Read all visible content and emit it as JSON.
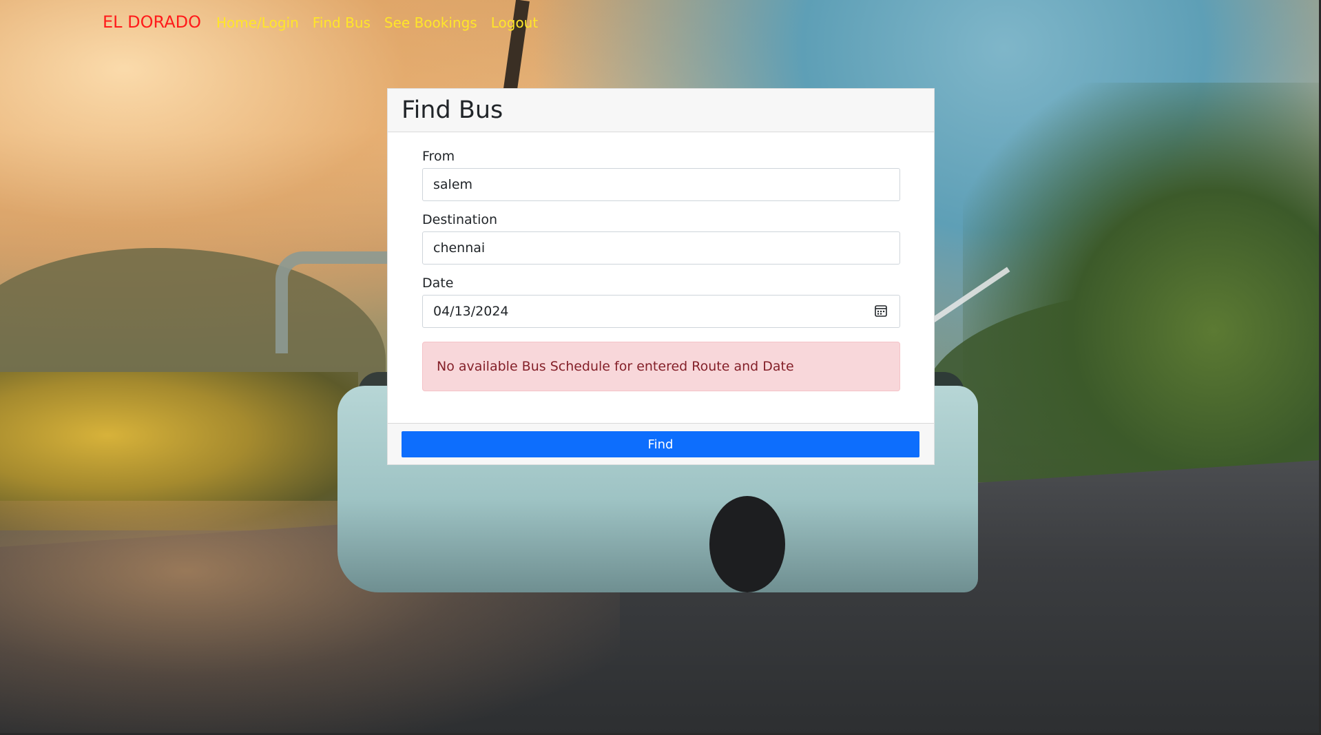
{
  "navbar": {
    "brand": "EL DORADO",
    "brand_color": "#ff1a1a",
    "link_color": "#ffe629",
    "links": [
      {
        "label": "Home/Login"
      },
      {
        "label": "Find Bus"
      },
      {
        "label": "See Bookings"
      },
      {
        "label": "Logout"
      }
    ]
  },
  "card": {
    "title": "Find Bus",
    "fields": {
      "from": {
        "label": "From",
        "value": "salem"
      },
      "destination": {
        "label": "Destination",
        "value": "chennai"
      },
      "date": {
        "label": "Date",
        "value": "04/13/2024",
        "icon": "calendar-icon"
      }
    },
    "alert": {
      "message": "No available Bus Schedule for entered Route and Date",
      "background": "#f8d7da",
      "text_color": "#842029"
    },
    "submit_label": "Find",
    "submit_color": "#0d6efd"
  }
}
